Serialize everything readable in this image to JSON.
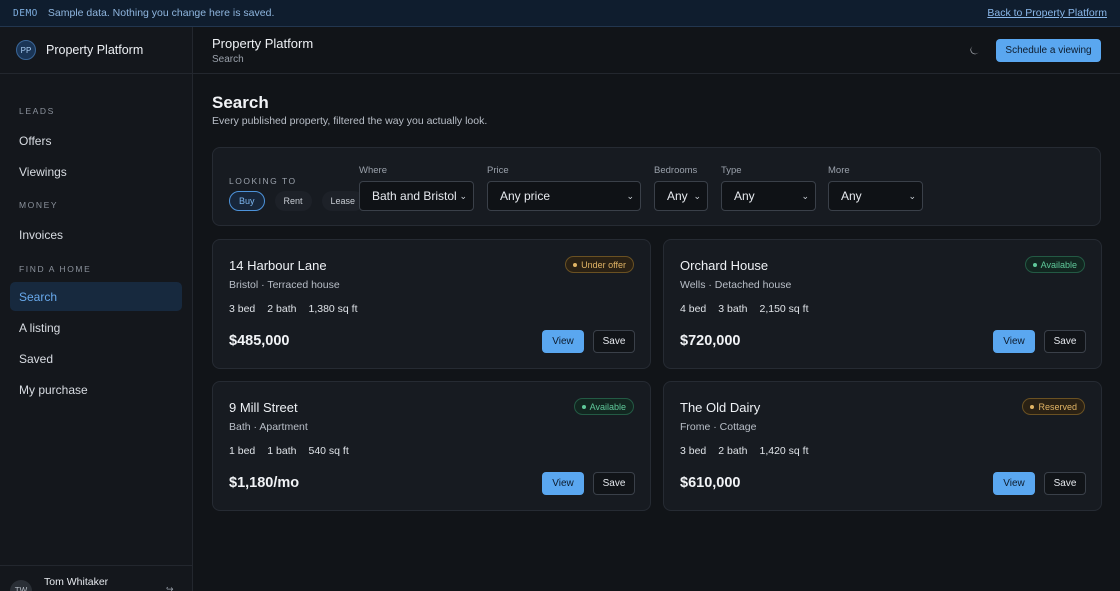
{
  "banner": {
    "tag": "DEMO",
    "message": "Sample data. Nothing you change here is saved.",
    "back_link": "Back to Property Platform"
  },
  "sidebar": {
    "brand_initials": "PP",
    "brand_name": "Property Platform",
    "sections": [
      {
        "heading": "LEADS",
        "items": [
          {
            "label": "Offers"
          },
          {
            "label": "Viewings"
          }
        ]
      },
      {
        "heading": "MONEY",
        "items": [
          {
            "label": "Invoices"
          }
        ]
      },
      {
        "heading": "FIND A HOME",
        "items": [
          {
            "label": "Search",
            "active": true
          },
          {
            "label": "A listing"
          },
          {
            "label": "Saved"
          },
          {
            "label": "My purchase"
          }
        ]
      }
    ],
    "user": {
      "initials": "TW",
      "name": "Tom Whitaker",
      "signout_icon": "↪"
    }
  },
  "topbar": {
    "title": "Property Platform",
    "breadcrumb": "Search",
    "theme_icon": "moon-icon",
    "cta_label": "Schedule a viewing"
  },
  "main": {
    "title": "Search",
    "subtitle": "Every published property, filtered the way you actually look."
  },
  "filters": {
    "looking_to_label": "LOOKING TO",
    "modes": [
      {
        "label": "Buy",
        "active": true
      },
      {
        "label": "Rent"
      },
      {
        "label": "Lease"
      }
    ],
    "where_label": "Where",
    "where_value": "Bath and Bristol",
    "price_label": "Price",
    "price_value": "Any price",
    "bedrooms_label": "Bedrooms",
    "bedrooms_value": "Any",
    "type_label": "Type",
    "type_value": "Any",
    "more_label": "More",
    "more_value": "Any"
  },
  "listings": [
    {
      "title": "14 Harbour Lane",
      "meta": "Bristol · Terraced house",
      "beds": "3 bed",
      "baths": "2 bath",
      "area": "1,380 sq ft",
      "price": "$485,000",
      "status": "Under offer",
      "status_kind": "warn",
      "view_label": "View",
      "save_label": "Save"
    },
    {
      "title": "Orchard House",
      "meta": "Wells · Detached house",
      "beds": "4 bed",
      "baths": "3 bath",
      "area": "2,150 sq ft",
      "price": "$720,000",
      "status": "Available",
      "status_kind": "ok",
      "view_label": "View",
      "save_label": "Save"
    },
    {
      "title": "9 Mill Street",
      "meta": "Bath · Apartment",
      "beds": "1 bed",
      "baths": "1 bath",
      "area": "540 sq ft",
      "price": "$1,180/mo",
      "status": "Available",
      "status_kind": "ok",
      "view_label": "View",
      "save_label": "Save"
    },
    {
      "title": "The Old Dairy",
      "meta": "Frome · Cottage",
      "beds": "3 bed",
      "baths": "2 bath",
      "area": "1,420 sq ft",
      "price": "$610,000",
      "status": "Reserved",
      "status_kind": "warn",
      "view_label": "View",
      "save_label": "Save"
    }
  ],
  "colors": {
    "accent": "#5aa7f0",
    "warning": "#e1b465",
    "success": "#5fc99a",
    "background": "#111418"
  }
}
